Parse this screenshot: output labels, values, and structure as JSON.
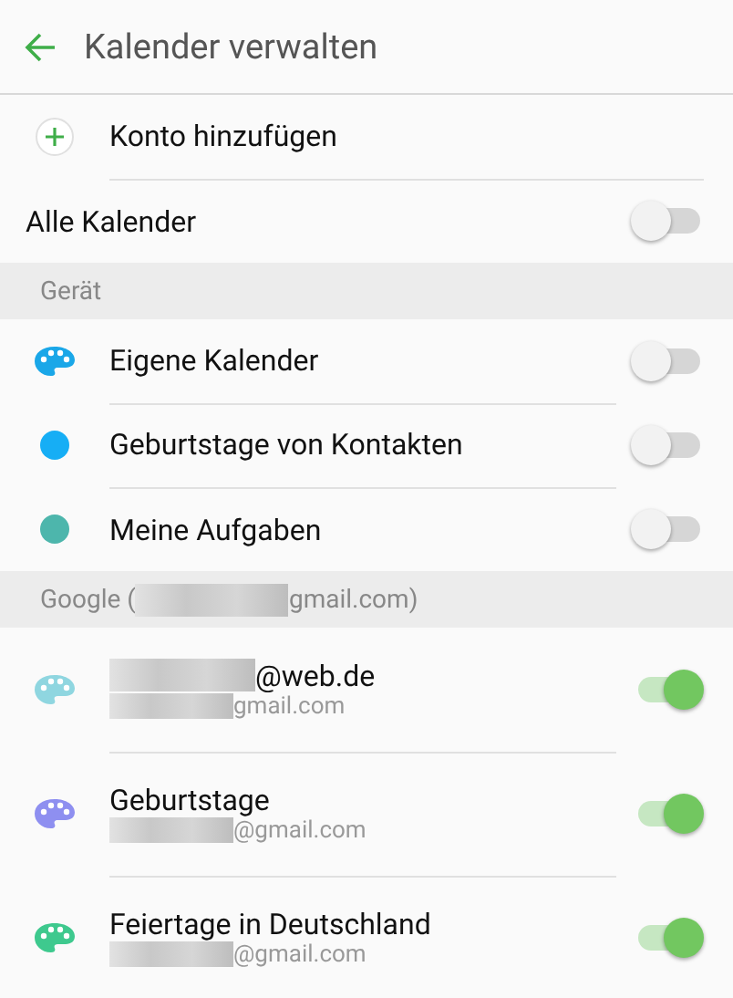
{
  "header": {
    "title": "Kalender verwalten"
  },
  "add_account": {
    "label": "Konto hinzufügen"
  },
  "all_calendars": {
    "label": "Alle Kalender",
    "on": false
  },
  "sections": [
    {
      "title_parts": [
        {
          "text": "Gerät",
          "redacted": false
        }
      ],
      "items": [
        {
          "kind": "palette",
          "color": "#1aa7e8",
          "title": {
            "text": "Eigene Kalender",
            "redacted": false
          },
          "on": false
        },
        {
          "kind": "dot",
          "color": "#16aef5",
          "title": {
            "text": "Geburtstage von Kontakten",
            "redacted": false
          },
          "on": false
        },
        {
          "kind": "dot",
          "color": "#4db6ac",
          "title": {
            "text": "Meine Aufgaben",
            "redacted": false
          },
          "on": false
        }
      ]
    },
    {
      "title_parts": [
        {
          "text": "Google (",
          "redacted": false
        },
        {
          "text": "gmail.com)",
          "redacted": true
        }
      ],
      "items": [
        {
          "kind": "palette",
          "color": "#8fd6e0",
          "title": {
            "text": "@web.de",
            "redacted": true
          },
          "subtitle": {
            "text": "gmail.com",
            "redacted": true
          },
          "on": true
        },
        {
          "kind": "palette",
          "color": "#8e8ff0",
          "title": {
            "text": "Geburtstage",
            "redacted": false
          },
          "subtitle": {
            "text": "@gmail.com",
            "redacted": true
          },
          "on": true
        },
        {
          "kind": "palette",
          "color": "#3ec98e",
          "title": {
            "text": "Feiertage in Deutschland",
            "redacted": false
          },
          "subtitle": {
            "text": "@gmail.com",
            "redacted": true
          },
          "on": true
        }
      ]
    }
  ]
}
